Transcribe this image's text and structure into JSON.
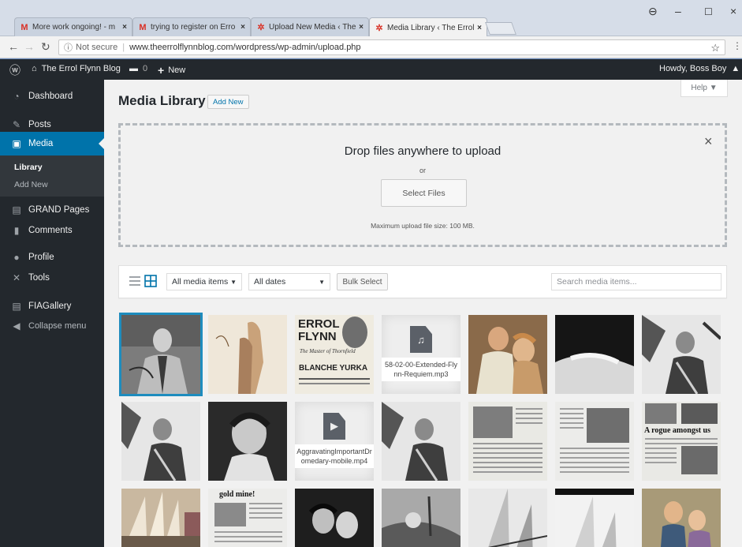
{
  "browser": {
    "tabs": [
      {
        "title": "More work ongoing! - m",
        "favicon": "M",
        "color": "#d93025"
      },
      {
        "title": "trying to register on Erro",
        "favicon": "M",
        "color": "#d93025"
      },
      {
        "title": "Upload New Media ‹ The",
        "favicon": "✲",
        "color": "#d9372c"
      },
      {
        "title": "Media Library ‹ The Errol",
        "favicon": "✲",
        "color": "#d9372c"
      }
    ],
    "tab_close": "×",
    "not_secure": "Not secure",
    "url": "www.theerrolflynnblog.com/wordpress/wp-admin/upload.php"
  },
  "adminbar": {
    "site_name": "The Errol Flynn Blog",
    "comments_count": "0",
    "new_label": "New",
    "howdy": "Howdy, Boss Boy"
  },
  "sidebar": {
    "items": [
      {
        "label": "Dashboard",
        "icon": "dashboard-icon",
        "glyph": "◔"
      },
      {
        "label": "Posts",
        "icon": "pin-icon",
        "glyph": "✎"
      },
      {
        "label": "Media",
        "icon": "media-icon",
        "glyph": "▣"
      },
      {
        "label": "GRAND Pages",
        "icon": "pages-icon",
        "glyph": "▤"
      },
      {
        "label": "Comments",
        "icon": "comments-icon",
        "glyph": "▮"
      },
      {
        "label": "Profile",
        "icon": "profile-icon",
        "glyph": "●"
      },
      {
        "label": "Tools",
        "icon": "tools-icon",
        "glyph": "✕"
      },
      {
        "label": "FIAGallery",
        "icon": "gallery-icon",
        "glyph": "▤"
      },
      {
        "label": "Collapse menu",
        "icon": "collapse-icon",
        "glyph": "◀"
      }
    ],
    "submenu": [
      "Library",
      "Add New"
    ]
  },
  "main": {
    "title": "Media Library",
    "add_new": "Add New",
    "help": "Help ▼",
    "dropzone": {
      "title": "Drop files anywhere to upload",
      "or": "or",
      "button": "Select Files",
      "max": "Maximum upload file size: 100 MB.",
      "close": "×"
    },
    "toolbar": {
      "filter_type": "All media items",
      "filter_date": "All dates",
      "bulk": "Bulk Select",
      "search_placeholder": "Search media items..."
    },
    "files": [
      {
        "name": "58-02-00-Extended-Flynn-Requiem.mp3",
        "icon": "audio-file-icon",
        "glyph": "♫"
      },
      {
        "name": "AggravatingImportantDromedary-mobile.mp4",
        "icon": "video-file-icon",
        "glyph": "▶"
      }
    ],
    "poster": {
      "line1": "ERROL",
      "line2": "FLYNN",
      "line3": "The Master of Thornfield",
      "line4": "BLANCHE YURKA"
    },
    "clipping_headline": "A rogue amongst us",
    "clipping_headline2": "gold mine!"
  }
}
